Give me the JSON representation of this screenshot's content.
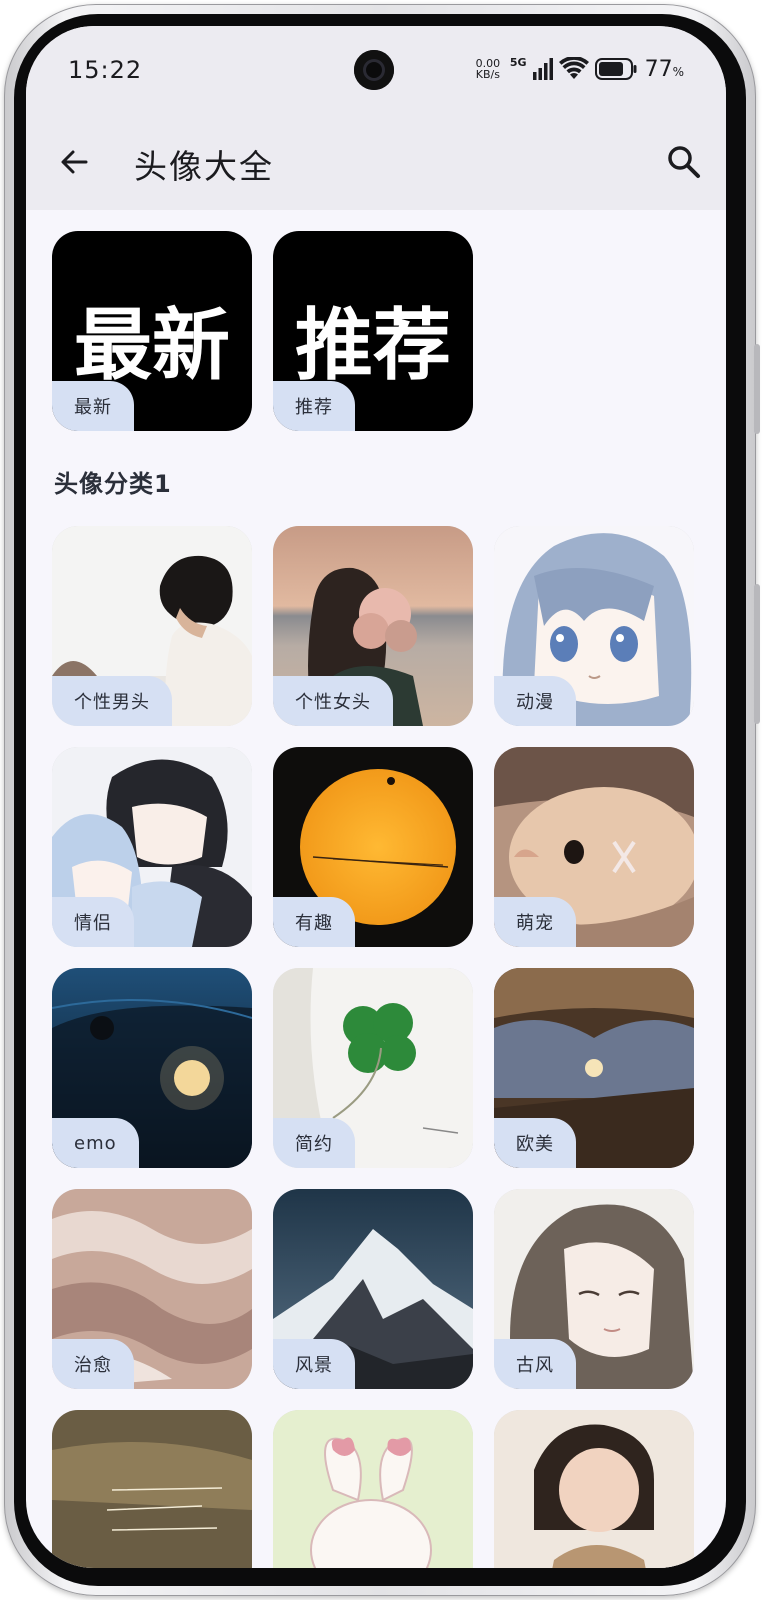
{
  "status_bar": {
    "time": "15:22",
    "net_speed_value": "0.00",
    "net_speed_unit": "KB/s",
    "network": "5G",
    "battery_percent": "77",
    "battery_unit": "%"
  },
  "app_bar": {
    "title": "头像大全"
  },
  "featured": [
    {
      "big_text": "最新",
      "label": "最新"
    },
    {
      "big_text": "推荐",
      "label": "推荐"
    }
  ],
  "section": {
    "title": "头像分类1"
  },
  "categories": [
    {
      "label": "个性男头"
    },
    {
      "label": "个性女头"
    },
    {
      "label": "动漫"
    },
    {
      "label": "情侣"
    },
    {
      "label": "有趣"
    },
    {
      "label": "萌宠"
    },
    {
      "label": "emo"
    },
    {
      "label": "简约"
    },
    {
      "label": "欧美"
    },
    {
      "label": "治愈"
    },
    {
      "label": "风景"
    },
    {
      "label": "古风"
    },
    {
      "label": ""
    },
    {
      "label": ""
    },
    {
      "label": ""
    }
  ],
  "colors": {
    "screen_bg": "#f7f6fc",
    "appbar_bg": "#ecebf1",
    "label_chip_bg": "#d6e0f3",
    "featured_bg": "#000000"
  }
}
